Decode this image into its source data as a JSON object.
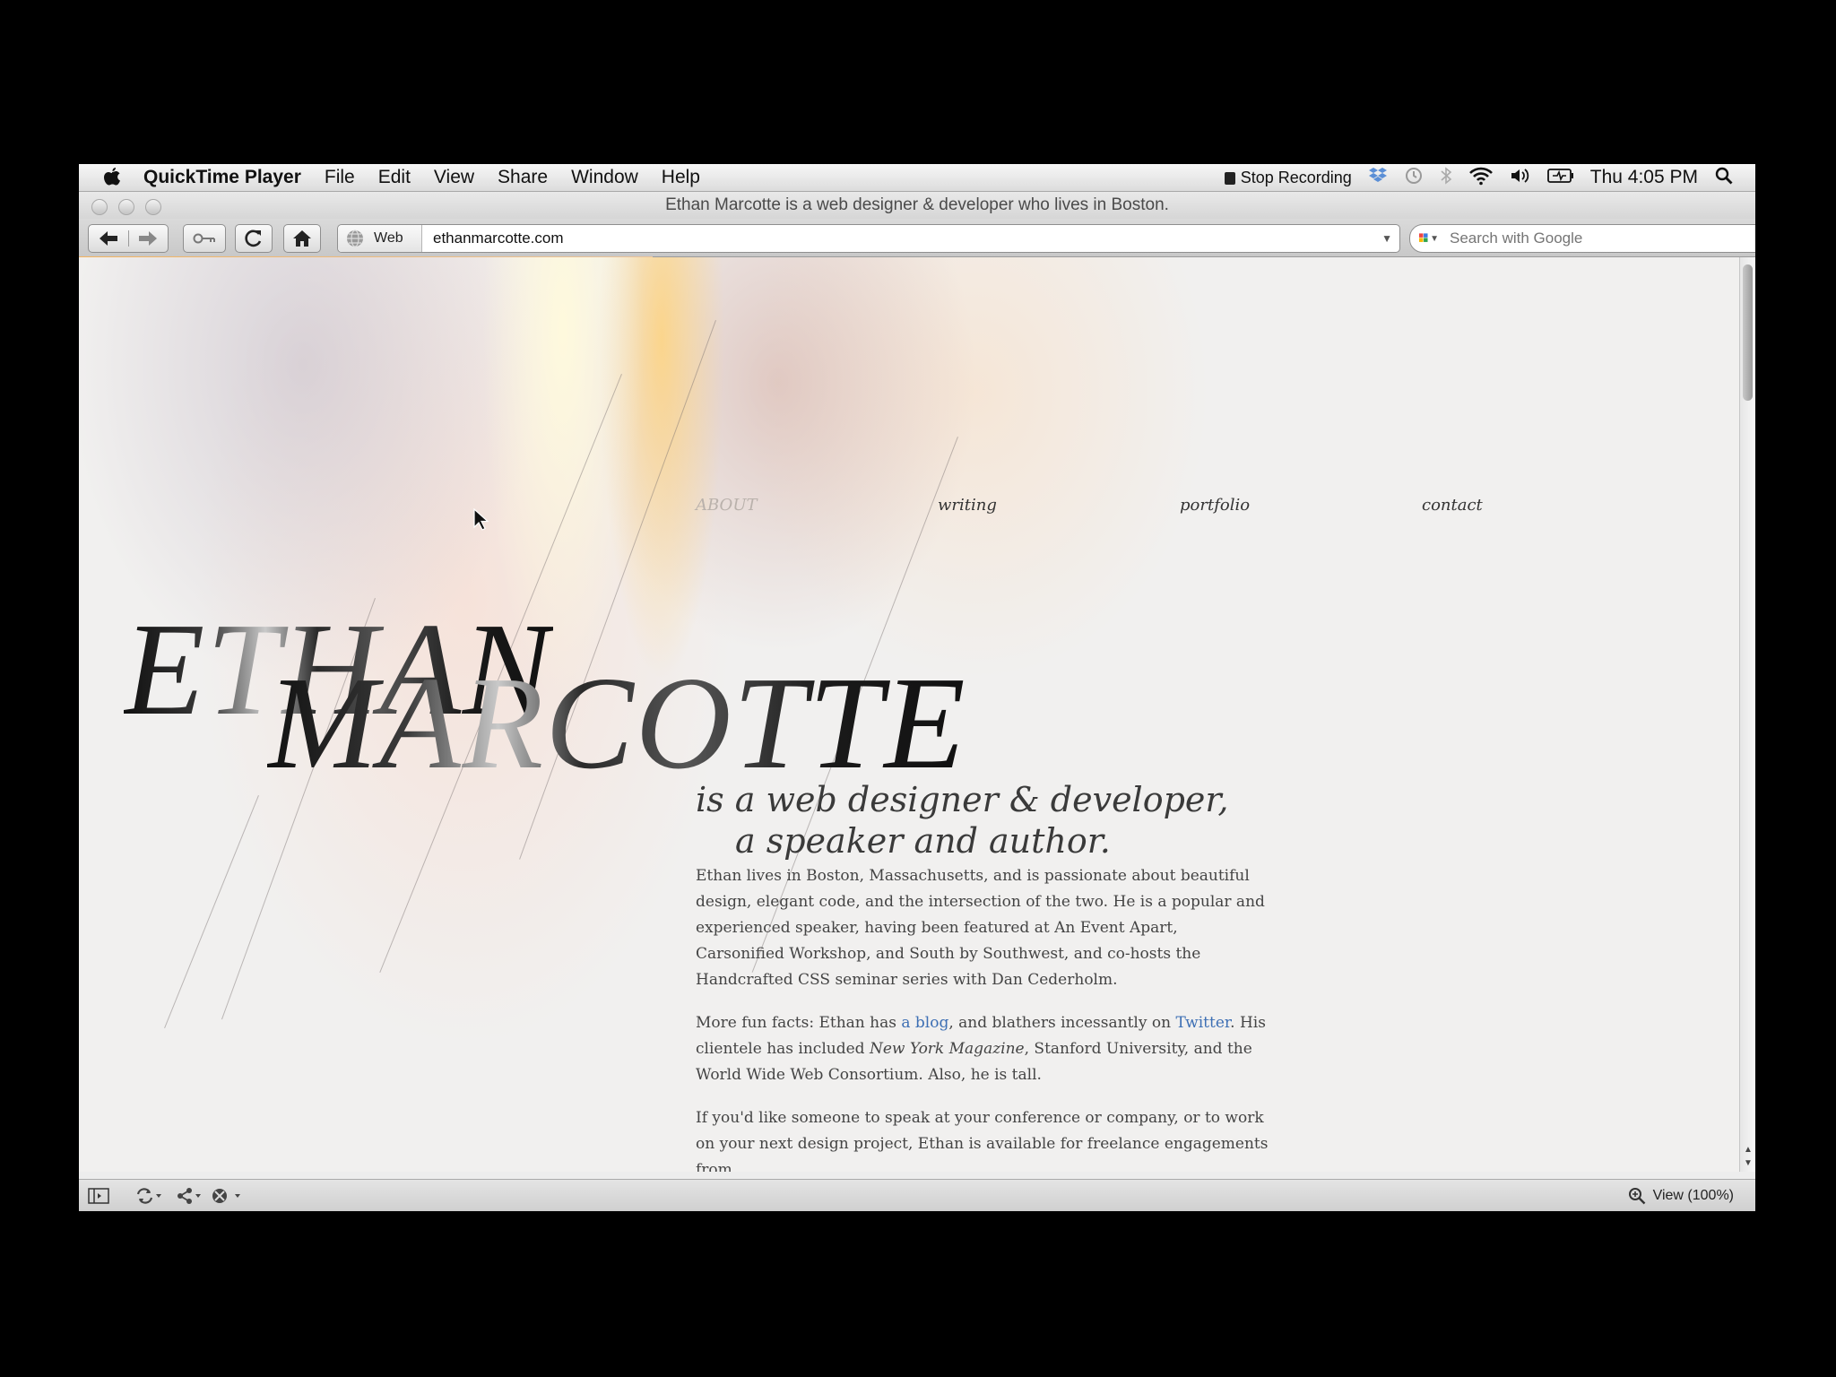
{
  "menubar": {
    "app": "QuickTime Player",
    "items": [
      "File",
      "Edit",
      "View",
      "Share",
      "Window",
      "Help"
    ],
    "stop_recording": "Stop Recording",
    "clock": "Thu 4:05 PM"
  },
  "window": {
    "title": "Ethan Marcotte is a web designer & developer who lives in Boston."
  },
  "toolbar": {
    "web_label": "Web",
    "url": "ethanmarcotte.com",
    "search_placeholder": "Search with Google"
  },
  "page": {
    "nav": [
      "ABOUT",
      "writing",
      "portfolio",
      "contact"
    ],
    "name_first": "ETHAN",
    "name_last": "MARCOTTE",
    "tagline_line1": "is a web designer & developer,",
    "tagline_line2": "a speaker and author.",
    "bio1": "Ethan lives in Boston, Massachusetts, and is passionate about beautiful design, elegant code, and the intersection of the two. He is a popular and experienced speaker, having been featured at An Event Apart, Carsonified Workshop, and South by Southwest, and co-hosts the Handcrafted CSS seminar series with Dan Cederholm.",
    "bio2_a": "More fun facts: Ethan has ",
    "bio2_link1": "a blog",
    "bio2_b": ", and blathers incessantly on ",
    "bio2_link2": "Twitter",
    "bio2_c": ". His clientele has included ",
    "bio2_em": "New York Magazine",
    "bio2_d": ", Stanford University, and the World Wide Web Consortium. Also, he is tall.",
    "bio3": "If you'd like someone to speak at your conference or company, or to work on your next design project, Ethan is available for freelance engagements from"
  },
  "statusbar": {
    "zoom": "View (100%)"
  },
  "colors": {
    "link": "#3d6fb4",
    "progress": "#f3b35e"
  }
}
